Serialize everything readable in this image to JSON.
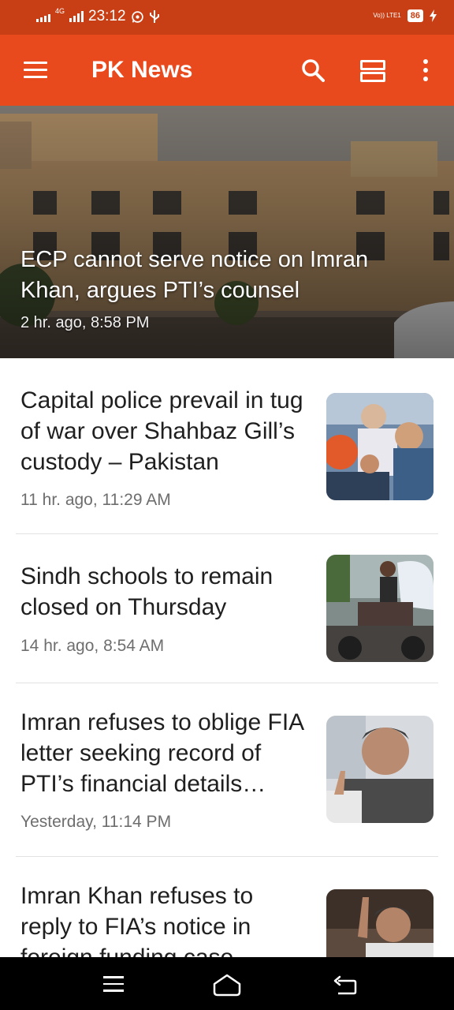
{
  "status_bar": {
    "network_small": "4G",
    "time": "23:12",
    "volte": "Vo)) LTE1",
    "battery": "86"
  },
  "app_bar": {
    "title": "PK News",
    "icons": [
      "menu-icon",
      "search-icon",
      "view-toggle-icon",
      "more-vert-icon"
    ]
  },
  "hero": {
    "title": "ECP cannot serve notice on Imran Khan, argues PTI’s counsel",
    "time": "2 hr. ago, 8:58 PM"
  },
  "articles": [
    {
      "title": "Capital police prevail in tug of war over Shahbaz Gill’s custody – Pakistan",
      "time": "11 hr. ago, 11:29 AM"
    },
    {
      "title": "Sindh schools to remain closed on Thursday",
      "time": "14 hr. ago, 8:54 AM"
    },
    {
      "title": "Imran refuses to oblige FIA letter seeking record of PTI’s financial details…",
      "time": "Yesterday, 11:14 PM"
    },
    {
      "title": "Imran Khan refuses to reply to FIA’s notice in foreign funding case",
      "time": ""
    }
  ],
  "nav_bar": {
    "icons": [
      "recents-menu-icon",
      "home-icon",
      "back-icon"
    ]
  },
  "colors": {
    "status_bar": "#c93f15",
    "app_bar": "#e8491d",
    "title_text": "#1f1f1f",
    "meta_text": "#6e6e6e"
  }
}
